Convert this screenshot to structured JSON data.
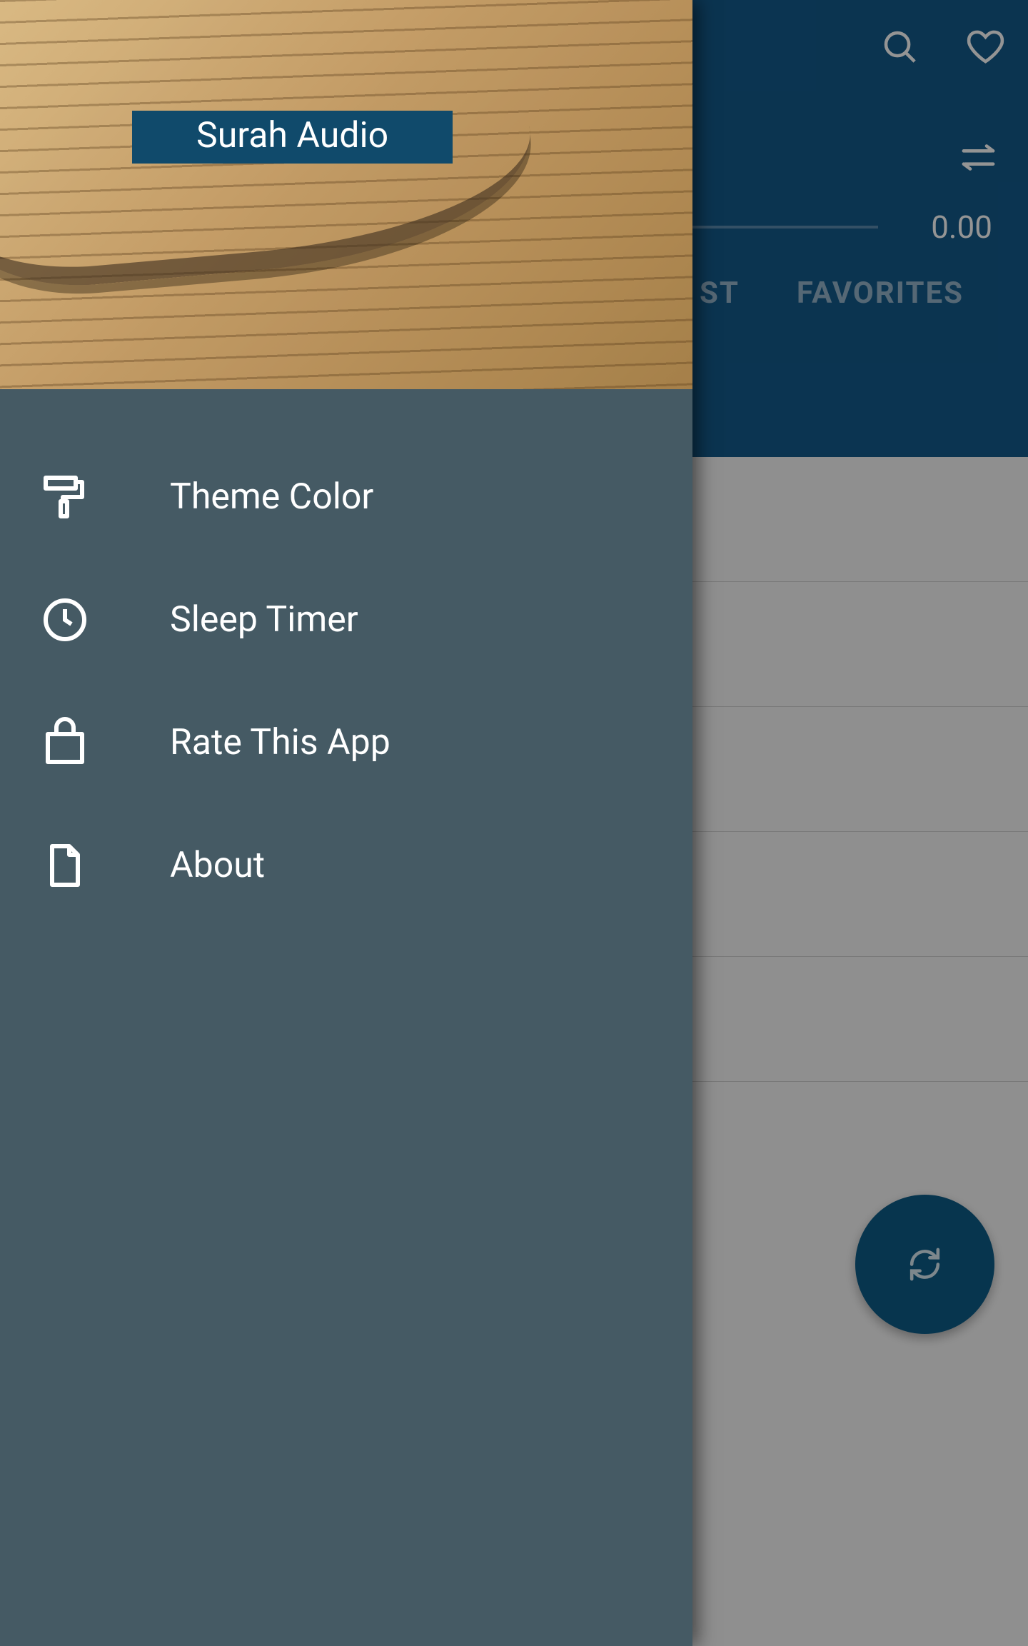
{
  "app": {
    "drawer_title": "Surah Audio"
  },
  "player": {
    "time": "0.00"
  },
  "tabs": {
    "playlist_partial": "ST",
    "favorites": "FAVORITES"
  },
  "drawer": {
    "items": [
      {
        "key": "theme",
        "label": "Theme Color"
      },
      {
        "key": "sleep",
        "label": "Sleep Timer"
      },
      {
        "key": "rate",
        "label": "Rate This App"
      },
      {
        "key": "about",
        "label": "About"
      }
    ]
  },
  "icons": {
    "search": "search-icon",
    "heart": "heart-icon",
    "repeat": "repeat-icon",
    "refresh": "refresh-icon"
  }
}
